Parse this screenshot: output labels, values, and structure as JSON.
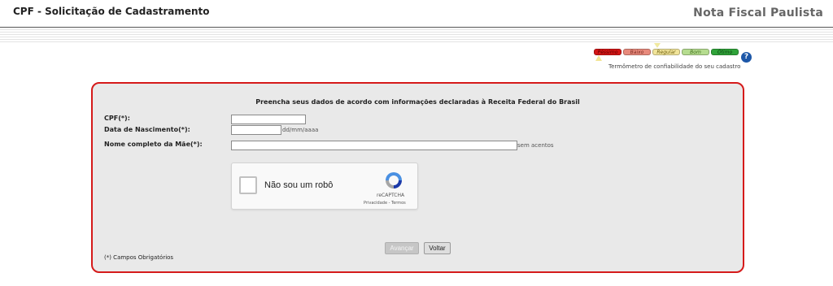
{
  "header": {
    "title": "CPF - Solicitação de Cadastramento",
    "brand": "Nota Fiscal Paulista"
  },
  "thermometer": {
    "levels": [
      "Péssimo",
      "Baixo",
      "Regular",
      "Bom",
      "Ótimo"
    ],
    "current_level": "Regular",
    "caption": "Termômetro de confiabilidade do seu cadastro",
    "help_icon": "question-icon",
    "help_symbol": "?",
    "colors": {
      "pessimo": "#d41515",
      "baixo": "#e88a7c",
      "regular": "#f1e49a",
      "bom": "#b5dc8f",
      "otimo": "#2fa339"
    }
  },
  "form": {
    "heading": "Preencha seus dados de acordo com informações declaradas à Receita Federal do Brasil",
    "cpf_label": "CPF(*):",
    "cpf_value": "",
    "birth_label": "Data de Nascimento(*):",
    "birth_value": "",
    "birth_hint": "dd/mm/aaaa",
    "mother_label": "Nome completo da Mãe(*):",
    "mother_value": "",
    "mother_hint": "sem acentos",
    "border_color": "#d51a1a"
  },
  "captcha": {
    "label": "Não sou um robô",
    "brand": "reCAPTCHA",
    "links": "Privacidade - Termos"
  },
  "buttons": {
    "next": "Avançar",
    "back": "Voltar"
  },
  "footnote": "(*) Campos Obrigatórios"
}
